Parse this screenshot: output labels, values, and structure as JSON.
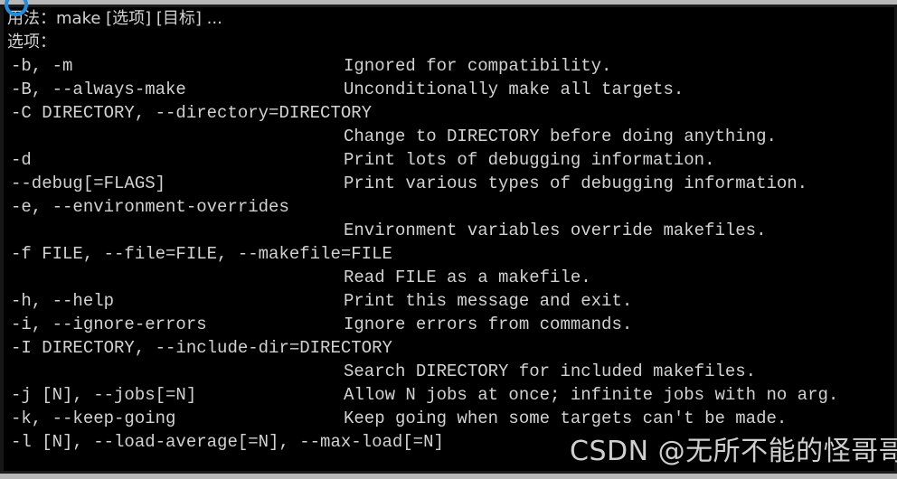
{
  "window": {
    "type": "terminal",
    "background_color": "#000000",
    "text_color": "#d2d2d2",
    "chrome_color": "#b8b8b8",
    "cursor_ring_color": "#1e8fe0"
  },
  "terminal": {
    "usage_line": "用法：make [选项] [目标] ...",
    "options_header": "选项：",
    "lines": [
      {
        "option": "-b, -m",
        "description": "Ignored for compatibility."
      },
      {
        "option": "-B, --always-make",
        "description": "Unconditionally make all targets."
      },
      {
        "option": "-C DIRECTORY, --directory=DIRECTORY",
        "description": ""
      },
      {
        "option": "",
        "description": "Change to DIRECTORY before doing anything."
      },
      {
        "option": "-d",
        "description": "Print lots of debugging information."
      },
      {
        "option": "--debug[=FLAGS]",
        "description": "Print various types of debugging information."
      },
      {
        "option": "-e, --environment-overrides",
        "description": ""
      },
      {
        "option": "",
        "description": "Environment variables override makefiles."
      },
      {
        "option": "-f FILE, --file=FILE, --makefile=FILE",
        "description": ""
      },
      {
        "option": "",
        "description": "Read FILE as a makefile."
      },
      {
        "option": "-h, --help",
        "description": "Print this message and exit."
      },
      {
        "option": "-i, --ignore-errors",
        "description": "Ignore errors from commands."
      },
      {
        "option": "-I DIRECTORY, --include-dir=DIRECTORY",
        "description": ""
      },
      {
        "option": "",
        "description": "Search DIRECTORY for included makefiles."
      },
      {
        "option": "-j [N], --jobs[=N]",
        "description": "Allow N jobs at once; infinite jobs with no arg."
      },
      {
        "option": "-k, --keep-going",
        "description": "Keep going when some targets can't be made."
      },
      {
        "option": "-l [N], --load-average[=N], --max-load[=N]",
        "description": ""
      }
    ]
  },
  "watermark": {
    "text": "CSDN @无所不能的怪哥哥"
  }
}
